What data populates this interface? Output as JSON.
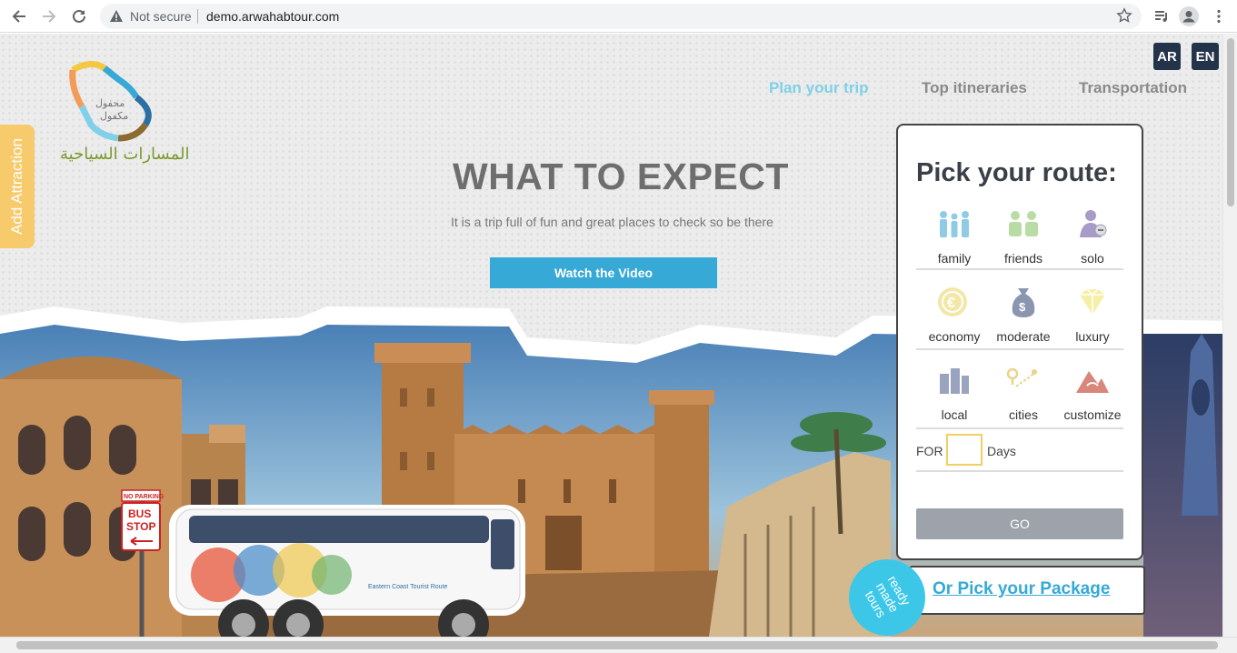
{
  "browser": {
    "security_label": "Not secure",
    "url": "demo.arwahabtour.com"
  },
  "site": {
    "logo_text_ar": "المسارات السياحية",
    "logo_inner_ar": "مكفول محفول",
    "lang_ar": "AR",
    "lang_en": "EN",
    "nav": [
      "Plan your trip",
      "Top itineraries",
      "Transportation"
    ],
    "side_tab": "Add Attraction"
  },
  "hero": {
    "headline": "WHAT TO EXPECT",
    "subline": "It is a trip full of fun and great places to check so be there",
    "watch_button": "Watch the Video"
  },
  "scene": {
    "bus_stop_sign": "BUS STOP",
    "no_parking": "NO PARKING"
  },
  "route_panel": {
    "title": "Pick your route:",
    "companions": [
      "family",
      "friends",
      "solo"
    ],
    "budgets": [
      "economy",
      "moderate",
      "luxury"
    ],
    "types": [
      "local",
      "cities",
      "customize"
    ],
    "for_label": "FOR",
    "days_label": "Days",
    "days_value": "",
    "go_button": "GO"
  },
  "package": {
    "badge": "ready made tours",
    "link": "Or Pick your Package"
  },
  "colors": {
    "accent_blue": "#36a9d6",
    "nav_active": "#7fd0e8",
    "side_tab": "#f7ca6b",
    "lang_bg": "#23344a",
    "go_button": "#9ea3ab",
    "badge": "#3cc7e8"
  }
}
